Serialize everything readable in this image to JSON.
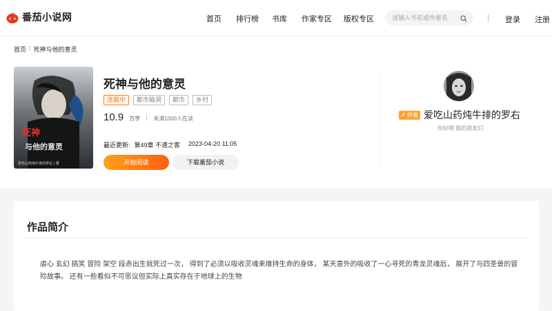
{
  "brand": {
    "name": "番茄小说网",
    "accent": "#ff5e14",
    "logo_color": "#e53a1e"
  },
  "nav": [
    {
      "label": "首页",
      "icon": ""
    },
    {
      "label": "排行榜",
      "icon": ""
    },
    {
      "label": "书库",
      "icon": ""
    },
    {
      "label": "作家专区",
      "icon": ""
    },
    {
      "label": "版权专区",
      "icon": ""
    }
  ],
  "search": {
    "placeholder": "请输入书名或作者名",
    "icon": "search-icon"
  },
  "header_links": {
    "login": "登录",
    "register": "注册"
  },
  "breadcrumb": {
    "home": "首页",
    "separator": "/",
    "current": "死神与他的意灵"
  },
  "book": {
    "title": "死神与他的意灵",
    "tags": [
      "连载中",
      "都市脑洞",
      "都市",
      "乡村"
    ],
    "word_count": "10.9",
    "word_unit": "万字",
    "readers": "未满1000人在读",
    "update_label": "最近更新:",
    "update_chapter": "第49章 不速之客",
    "update_time": "2023-04-20 11:05",
    "cover_text": "死神与他的意灵",
    "cover_footer": "爱吃山药炖牛排的罗右 | 著"
  },
  "actions": {
    "read": "开始阅读",
    "download": "下载番茄小说"
  },
  "author": {
    "badge": "作者",
    "name": "爱吃山药炖牛排的罗右",
    "bio": "你好啊 我的朋友们"
  },
  "intro": {
    "heading": "作品简介",
    "text": "虐心 玄幻 搞笑 冒险 架空 段赤出生就死过一次， 得到了必须以吸收灵魂来维持生命的身体， 某天意外的吸收了一心寻死的青龙灵魂后， 展开了与四圣兽的冒险故事。 还有一些看似不可思议但实际上真实存在于地球上的生物"
  }
}
